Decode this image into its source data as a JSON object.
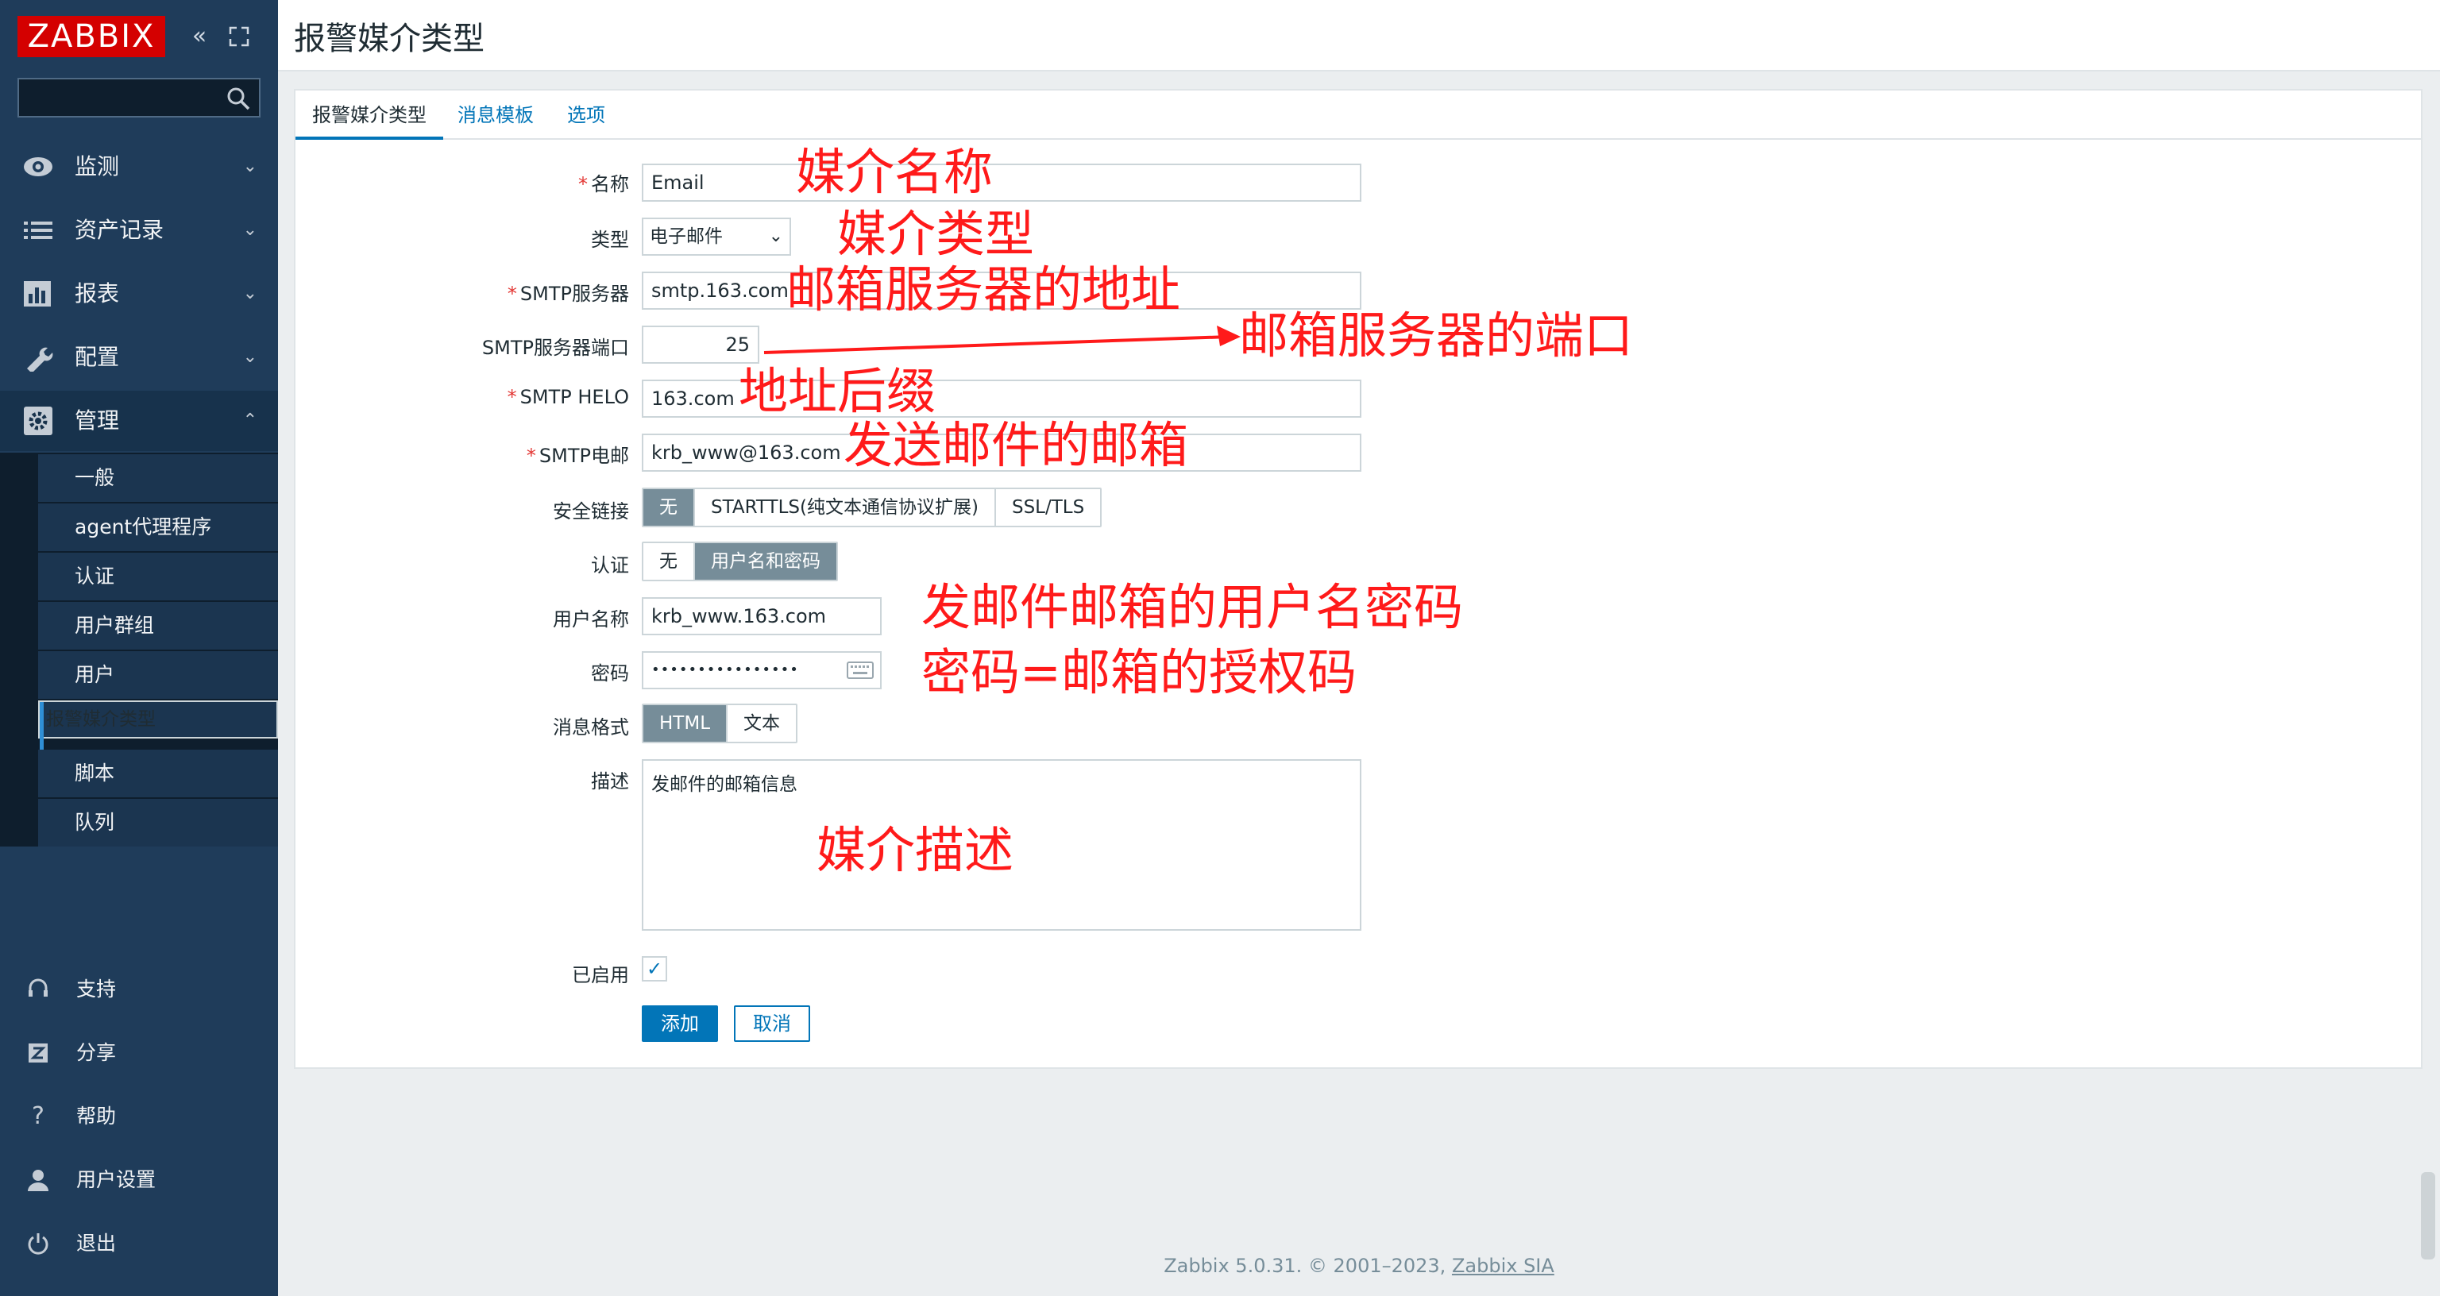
{
  "sidebar": {
    "logo": "ZABBIX",
    "collapse_icon": "double-chevron-left-icon",
    "kiosk_icon": "fullscreen-icon",
    "search_placeholder": "",
    "nav": [
      {
        "label": "监测",
        "icon": "eye-icon"
      },
      {
        "label": "资产记录",
        "icon": "list-icon"
      },
      {
        "label": "报表",
        "icon": "bar-chart-icon"
      },
      {
        "label": "配置",
        "icon": "wrench-icon"
      },
      {
        "label": "管理",
        "icon": "gear-icon"
      }
    ],
    "admin_submenu": [
      "一般",
      "agent代理程序",
      "认证",
      "用户群组",
      "用户",
      "报警媒介类型",
      "脚本",
      "队列"
    ],
    "bottom": [
      {
        "label": "支持",
        "icon": "headset-icon"
      },
      {
        "label": "分享",
        "icon": "share-z-icon"
      },
      {
        "label": "帮助",
        "icon": "question-icon"
      },
      {
        "label": "用户设置",
        "icon": "user-icon"
      },
      {
        "label": "退出",
        "icon": "power-icon"
      }
    ]
  },
  "header": {
    "title": "报警媒介类型"
  },
  "tabs": [
    "报警媒介类型",
    "消息模板",
    "选项"
  ],
  "form": {
    "name_label": "名称",
    "name_value": "Email",
    "type_label": "类型",
    "type_value": "电子邮件",
    "smtp_server_label": "SMTP服务器",
    "smtp_server_value": "smtp.163.com",
    "smtp_port_label": "SMTP服务器端口",
    "smtp_port_value": "25",
    "smtp_helo_label": "SMTP HELO",
    "smtp_helo_value": "163.com",
    "smtp_email_label": "SMTP电邮",
    "smtp_email_value": "krb_www@163.com",
    "security_label": "安全链接",
    "security_options": [
      "无",
      "STARTTLS(纯文本通信协议扩展)",
      "SSL/TLS"
    ],
    "security_selected": "无",
    "auth_label": "认证",
    "auth_options": [
      "无",
      "用户名和密码"
    ],
    "auth_selected": "用户名和密码",
    "username_label": "用户名称",
    "username_value": "krb_www.163.com",
    "password_label": "密码",
    "password_value": "••••••••••••••••",
    "format_label": "消息格式",
    "format_options": [
      "HTML",
      "文本"
    ],
    "format_selected": "HTML",
    "description_label": "描述",
    "description_value": "发邮件的邮箱信息",
    "enabled_label": "已启用",
    "enabled": true,
    "add_button": "添加",
    "cancel_button": "取消"
  },
  "annotations": [
    "媒介名称",
    "媒介类型",
    "邮箱服务器的地址",
    "邮箱服务器的端口",
    "地址后缀",
    "发送邮件的邮箱",
    "发邮件邮箱的用户名密码",
    "密码=邮箱的授权码",
    "媒介描述"
  ],
  "annotation_color": "#ff1a1a",
  "accent_color": "#0275b8",
  "footer": {
    "text": "Zabbix 5.0.31. © 2001–2023, ",
    "link": "Zabbix SIA"
  }
}
